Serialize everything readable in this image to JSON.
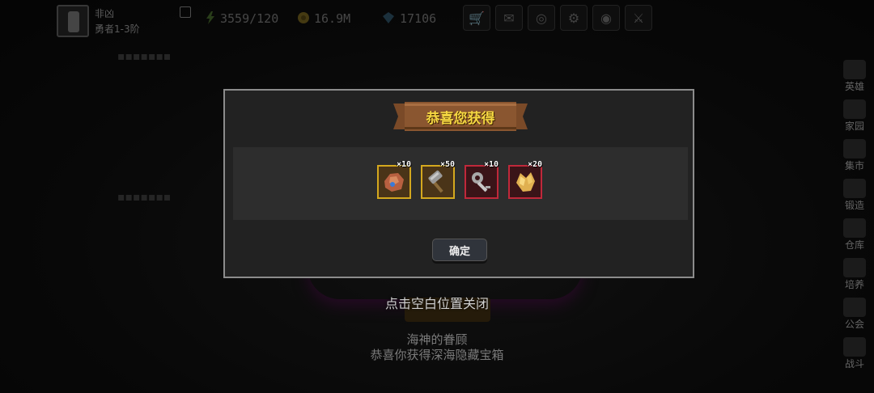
{
  "player": {
    "name": "非凶",
    "rank": "勇者1-3阶"
  },
  "resources": {
    "stamina": "3559/120",
    "gold": "16.9M",
    "gems": "17106"
  },
  "top_icons": [
    "shop-icon",
    "mail-icon",
    "gamepad-icon",
    "gear-icon",
    "palette-icon",
    "sword-icon"
  ],
  "sidebar": {
    "items": [
      {
        "label": "英雄",
        "icon": "hero-icon"
      },
      {
        "label": "家园",
        "icon": "home-icon"
      },
      {
        "label": "集市",
        "icon": "market-icon"
      },
      {
        "label": "锻造",
        "icon": "forge-icon"
      },
      {
        "label": "仓库",
        "icon": "warehouse-icon"
      },
      {
        "label": "培养",
        "icon": "train-icon"
      },
      {
        "label": "公会",
        "icon": "guild-icon"
      },
      {
        "label": "战斗",
        "icon": "battle-icon"
      }
    ]
  },
  "background": {
    "close_hint": "点击空白位置关闭",
    "bless_title": "海神的眷顾",
    "bless_text": "恭喜你获得深海隐藏宝箱"
  },
  "dialog": {
    "title": "恭喜您获得",
    "confirm_label": "确定",
    "rewards": [
      {
        "icon": "ore-chunk-icon",
        "quantity": "×10",
        "border": "#d4a81e",
        "bg": "#4a3418"
      },
      {
        "icon": "hammer-icon",
        "quantity": "×50",
        "border": "#d4a81e",
        "bg": "#4a3418"
      },
      {
        "icon": "silver-key-icon",
        "quantity": "×10",
        "border": "#c0283a",
        "bg": "#3a1418"
      },
      {
        "icon": "gold-crystal-icon",
        "quantity": "×20",
        "border": "#c0283a",
        "bg": "#3a1418"
      }
    ]
  },
  "colors": {
    "title_gold": "#f5d742",
    "dialog_bg": "#222222",
    "tray_bg": "#2d2d2d"
  }
}
